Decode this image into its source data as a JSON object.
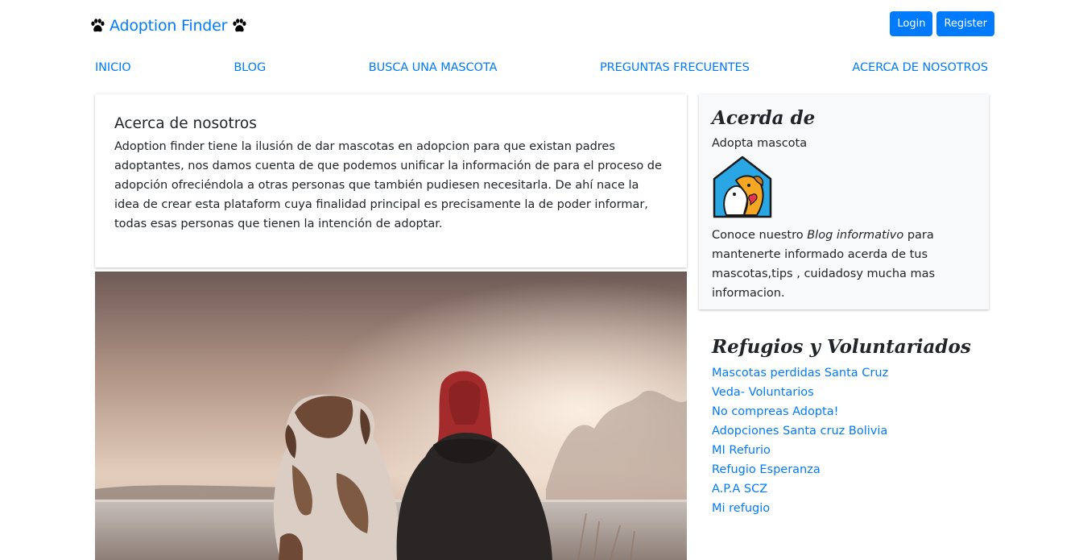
{
  "brand": {
    "title": "Adoption Finder",
    "color": "#007bff",
    "icon": "paw-icon"
  },
  "auth": {
    "login": "Login",
    "register": "Register"
  },
  "nav": [
    "INICIO",
    "BLOG",
    "BUSCA UNA MASCOTA",
    "PREGUNTAS FRECUENTES",
    "ACERCA DE NOSOTROS"
  ],
  "about": {
    "title": "Acerca de nosotros",
    "body": "Adoption finder tiene la ilusión de dar mascotas en adopcion para que existan padres adoptantes, nos damos cuenta de que podemos unificar la información de para el proceso de adopción ofreciéndola a otras personas que también pudiesen necesitarla. De ahí nace la idea de crear esta plataform cuya finalidad principal es precisamente la de poder informar, todas esas personas que tienen la intención de adoptar."
  },
  "sidebar": {
    "title": "Acerda de",
    "subtitle": "Adopta mascota",
    "desc_before": "Conoce nuestro ",
    "desc_em": "Blog informativo",
    "desc_after": " para mantenerte informado acerda de tus mascotas,tips , cuidadosy mucha mas informacion."
  },
  "refugios": {
    "title": "Refugios y Voluntariados",
    "links": [
      "Mascotas perdidas Santa Cruz",
      "Veda- Voluntarios",
      "No compreas Adopta!",
      "Adopciones Santa cruz Bolivia",
      "MI Refurio",
      "Refugio Esperanza",
      "A.P.A SCZ",
      "Mi refugio"
    ]
  }
}
